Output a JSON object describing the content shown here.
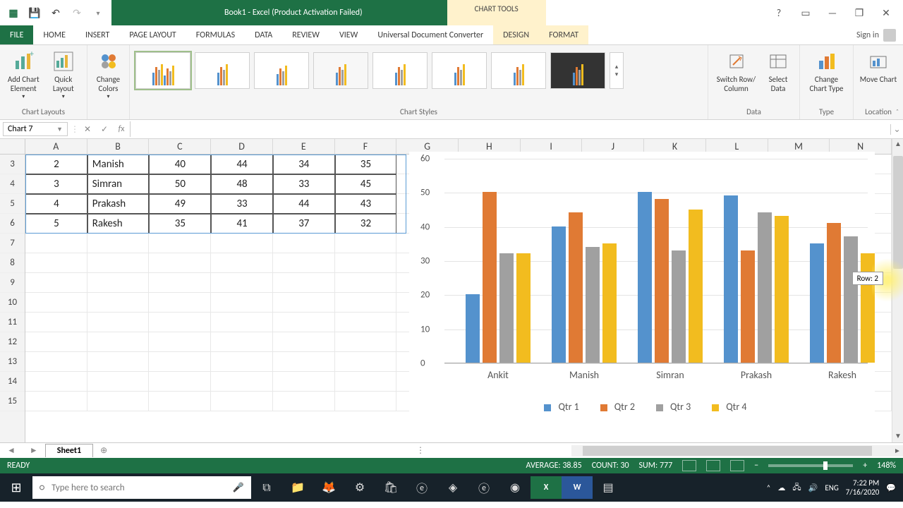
{
  "titlebar": {
    "title": "Book1 - Excel (Product Activation Failed)",
    "chart_tools": "CHART TOOLS"
  },
  "window_controls": {
    "help": "?",
    "full": "▭",
    "min": "—",
    "restore": "❐",
    "close": "✕"
  },
  "tabs": {
    "file": "FILE",
    "home": "HOME",
    "insert": "INSERT",
    "page_layout": "PAGE LAYOUT",
    "formulas": "FORMULAS",
    "data": "DATA",
    "review": "REVIEW",
    "view": "VIEW",
    "udc": "Universal Document Converter",
    "design": "DESIGN",
    "format": "FORMAT",
    "signin": "Sign in"
  },
  "ribbon": {
    "chart_layouts": "Chart Layouts",
    "add_chart_element": "Add Chart Element",
    "quick_layout": "Quick Layout",
    "change_colors": "Change Colors",
    "chart_styles": "Chart Styles",
    "switch_row_col": "Switch Row/ Column",
    "select_data": "Select Data",
    "data_group": "Data",
    "change_chart_type": "Change Chart Type",
    "type_group": "Type",
    "move_chart": "Move Chart",
    "location_group": "Location"
  },
  "namebox": "Chart 7",
  "columns": [
    "A",
    "B",
    "C",
    "D",
    "E",
    "F",
    "G",
    "H",
    "I",
    "J",
    "K",
    "L",
    "M",
    "N"
  ],
  "row_numbers": [
    3,
    4,
    5,
    6,
    7,
    8,
    9,
    10,
    11,
    12,
    13,
    14,
    15
  ],
  "table_rows": [
    {
      "A": "2",
      "B": "Manish",
      "C": "40",
      "D": "44",
      "E": "34",
      "F": "35"
    },
    {
      "A": "3",
      "B": "Simran",
      "C": "50",
      "D": "48",
      "E": "33",
      "F": "45"
    },
    {
      "A": "4",
      "B": "Prakash",
      "C": "49",
      "D": "33",
      "E": "44",
      "F": "43"
    },
    {
      "A": "5",
      "B": "Rakesh",
      "C": "35",
      "D": "41",
      "E": "37",
      "F": "32"
    }
  ],
  "scroll_tooltip": "Row: 2",
  "chart_data": {
    "type": "bar",
    "categories": [
      "Ankit",
      "Manish",
      "Simran",
      "Prakash",
      "Rakesh"
    ],
    "series": [
      {
        "name": "Qtr 1",
        "color": "#5492cd",
        "values": [
          20,
          40,
          50,
          49,
          35
        ]
      },
      {
        "name": "Qtr 2",
        "color": "#e07a34",
        "values": [
          50,
          44,
          48,
          33,
          41
        ]
      },
      {
        "name": "Qtr 3",
        "color": "#a0a0a0",
        "values": [
          32,
          34,
          33,
          44,
          37
        ]
      },
      {
        "name": "Qtr 4",
        "color": "#f2bc1f",
        "values": [
          32,
          35,
          45,
          43,
          32
        ]
      }
    ],
    "ylim": [
      0,
      60
    ],
    "yticks": [
      0,
      10,
      20,
      30,
      40,
      50,
      60
    ]
  },
  "sheet": {
    "name": "Sheet1"
  },
  "status": {
    "ready": "READY",
    "average": "AVERAGE: 38.85",
    "count": "COUNT: 30",
    "sum": "SUM: 777",
    "zoom": "148%"
  },
  "taskbar": {
    "search_placeholder": "Type here to search",
    "lang": "ENG",
    "time": "7:22 PM",
    "date": "7/16/2020"
  }
}
